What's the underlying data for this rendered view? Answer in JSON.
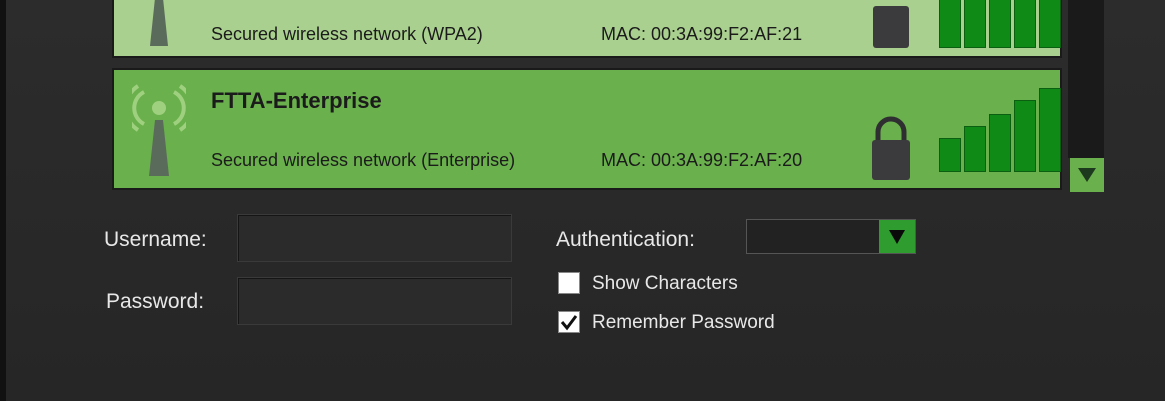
{
  "networks": [
    {
      "name": "",
      "security": "Secured wireless network (WPA2)",
      "mac": "MAC: 00:3A:99:F2:AF:21",
      "selected": false,
      "signal_bars": 5,
      "icons": {
        "tower": "wifi-tower-icon",
        "lock": "lock-icon"
      }
    },
    {
      "name": "FTTA-Enterprise",
      "security": "Secured wireless network (Enterprise)",
      "mac": "MAC: 00:3A:99:F2:AF:20",
      "selected": true,
      "signal_bars": 5,
      "icons": {
        "tower": "wifi-tower-broadcasting-icon",
        "lock": "lock-icon"
      }
    }
  ],
  "scrollbar": {
    "down_icon": "scroll-down-arrow-icon"
  },
  "credentials": {
    "username_label": "Username:",
    "username_value": "",
    "password_label": "Password:",
    "password_value": ""
  },
  "authentication": {
    "label": "Authentication:",
    "selected": "",
    "dropdown_icon": "dropdown-arrow-icon"
  },
  "options": {
    "show_characters": {
      "label": "Show Characters",
      "checked": false
    },
    "remember_password": {
      "label": "Remember Password",
      "checked": true
    }
  },
  "colors": {
    "selected_row": "#6ab04c",
    "unselected_row": "#a9d08e",
    "signal_bar": "#0f8a17",
    "dropdown_button": "#2e9c2e",
    "background": "#2a2a2a"
  }
}
